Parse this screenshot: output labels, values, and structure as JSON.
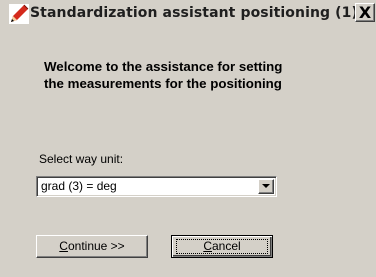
{
  "window": {
    "title": "Standardization assistant positioning (1)",
    "close_label": "X"
  },
  "content": {
    "welcome_line1": "Welcome to the assistance for setting",
    "welcome_line2": "the measurements for the positioning",
    "select_label": "Select way unit:",
    "unit_select": {
      "selected_value": "grad (3) = deg"
    }
  },
  "buttons": {
    "continue_accel": "C",
    "continue_rest": "ontinue >>",
    "cancel_accel": "C",
    "cancel_rest": "ancel"
  },
  "icons": {
    "app": "pencil-icon",
    "close": "close-icon",
    "dropdown": "chevron-down-icon"
  },
  "colors": {
    "window_bg": "#d4d0c8",
    "title_text": "#1f1f1f",
    "icon_red": "#d42a1c"
  }
}
